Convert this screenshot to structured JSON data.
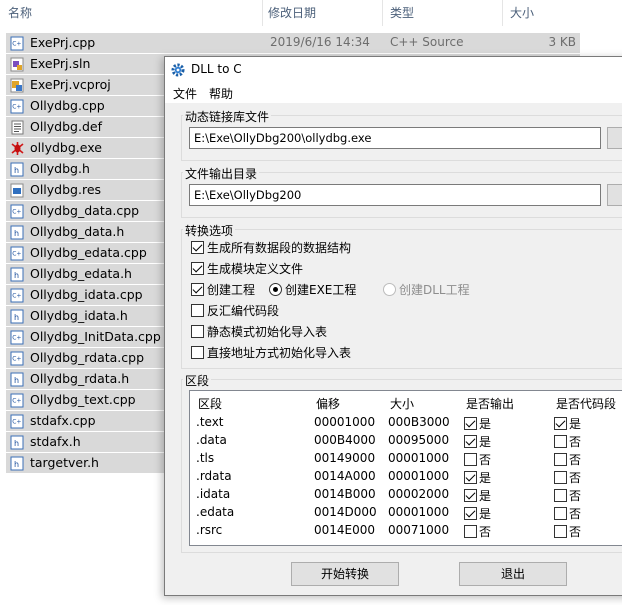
{
  "explorer": {
    "columns": {
      "name": "名称",
      "date": "修改日期",
      "type": "类型",
      "size": "大小"
    },
    "files": [
      {
        "name": "ExePrj.cpp",
        "date": "2019/6/16 14:34",
        "type": "C++ Source",
        "size": "3 KB",
        "icon": "cpp-file-icon"
      },
      {
        "name": "ExePrj.sln",
        "icon": "sln-file-icon"
      },
      {
        "name": "ExePrj.vcproj",
        "icon": "vcproj-file-icon"
      },
      {
        "name": "Ollydbg.cpp",
        "icon": "cpp-file-icon"
      },
      {
        "name": "Ollydbg.def",
        "icon": "def-file-icon"
      },
      {
        "name": "ollydbg.exe",
        "icon": "bug-exe-icon"
      },
      {
        "name": "Ollydbg.h",
        "icon": "header-file-icon"
      },
      {
        "name": "Ollydbg.res",
        "icon": "res-file-icon"
      },
      {
        "name": "Ollydbg_data.cpp",
        "icon": "cpp-file-icon"
      },
      {
        "name": "Ollydbg_data.h",
        "icon": "header-file-icon"
      },
      {
        "name": "Ollydbg_edata.cpp",
        "icon": "cpp-file-icon"
      },
      {
        "name": "Ollydbg_edata.h",
        "icon": "header-file-icon"
      },
      {
        "name": "Ollydbg_idata.cpp",
        "icon": "cpp-file-icon"
      },
      {
        "name": "Ollydbg_idata.h",
        "icon": "header-file-icon"
      },
      {
        "name": "Ollydbg_InitData.cpp",
        "icon": "cpp-file-icon"
      },
      {
        "name": "Ollydbg_rdata.cpp",
        "icon": "cpp-file-icon"
      },
      {
        "name": "Ollydbg_rdata.h",
        "icon": "header-file-icon"
      },
      {
        "name": "Ollydbg_text.cpp",
        "icon": "cpp-file-icon"
      },
      {
        "name": "stdafx.cpp",
        "icon": "cpp-file-icon"
      },
      {
        "name": "stdafx.h",
        "icon": "header-file-icon"
      },
      {
        "name": "targetver.h",
        "icon": "header-file-icon"
      }
    ]
  },
  "dialog": {
    "title": "DLL to C",
    "menu": [
      "文件",
      "帮助"
    ],
    "dll_group": {
      "label": "动态链接库文件",
      "path": "E:\\Exe\\OllyDbg200\\ollydbg.exe"
    },
    "output_group": {
      "label": "文件输出目录",
      "path": "E:\\Exe\\OllyDbg200"
    },
    "options_group": {
      "label": "转换选项",
      "opt1": "生成所有数据段的数据结构",
      "opt2": "生成模块定义文件",
      "opt3": "创建工程",
      "radio_exe": "创建EXE工程",
      "radio_dll": "创建DLL工程",
      "opt4": "反汇编代码段",
      "opt5": "静态模式初始化导入表",
      "opt6": "直接地址方式初始化导入表"
    },
    "sections_group": {
      "label": "区段",
      "headers": [
        "区段",
        "偏移",
        "大小",
        "是否输出",
        "是否代码段"
      ],
      "rows": [
        {
          "name": ".text",
          "offset": "00001000",
          "size": "000B3000",
          "out": "是",
          "code": "是"
        },
        {
          "name": ".data",
          "offset": "000B4000",
          "size": "00095000",
          "out": "是",
          "code": "否"
        },
        {
          "name": ".tls",
          "offset": "00149000",
          "size": "00001000",
          "out": "否",
          "code": "否"
        },
        {
          "name": ".rdata",
          "offset": "0014A000",
          "size": "00001000",
          "out": "是",
          "code": "否"
        },
        {
          "name": ".idata",
          "offset": "0014B000",
          "size": "00002000",
          "out": "是",
          "code": "否"
        },
        {
          "name": ".edata",
          "offset": "0014D000",
          "size": "00001000",
          "out": "是",
          "code": "否"
        },
        {
          "name": ".rsrc",
          "offset": "0014E000",
          "size": "00071000",
          "out": "否",
          "code": "否"
        }
      ]
    },
    "buttons": {
      "start": "开始转换",
      "exit": "退出"
    }
  },
  "state": {
    "opt1": true,
    "opt2": true,
    "opt3": true,
    "radio": "exe",
    "opt4": false,
    "opt5": false,
    "opt6": false,
    "row_out": [
      true,
      true,
      false,
      true,
      true,
      true,
      false
    ],
    "row_code": [
      true,
      false,
      false,
      false,
      false,
      false,
      false
    ]
  }
}
